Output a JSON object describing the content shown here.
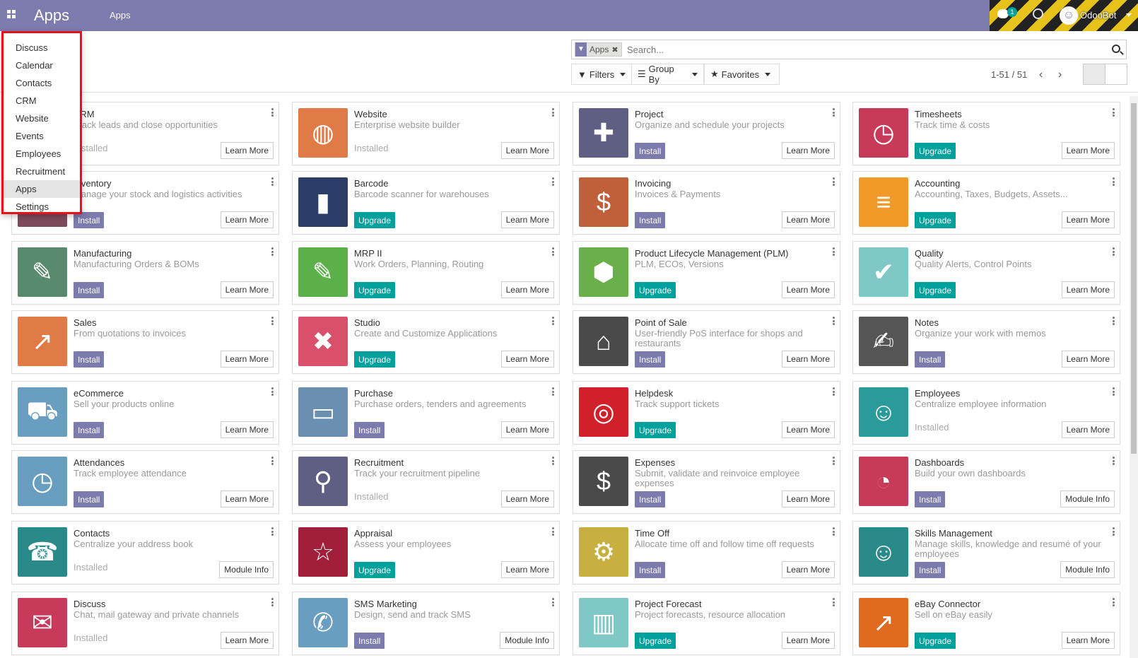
{
  "navbar": {
    "brand": "Apps",
    "menu_apps": "Apps",
    "chat_badge": "1",
    "user_name": "OdooBot"
  },
  "search": {
    "facet_label": "Apps",
    "placeholder": "Search..."
  },
  "filters": {
    "filters_label": "Filters",
    "group_by_label": "Group By",
    "favorites_label": "Favorites"
  },
  "pager": {
    "value": "1-51 / 51"
  },
  "dropdown": {
    "items": [
      "Discuss",
      "Calendar",
      "Contacts",
      "CRM",
      "Website",
      "Events",
      "Employees",
      "Recruitment",
      "Apps",
      "Settings"
    ],
    "active": "Apps"
  },
  "apps": [
    {
      "name": "CRM",
      "summary": "Track leads and close opportunities",
      "status": "Installed",
      "more": "Learn More",
      "color": "#c0504d",
      "icon": "handshake-icon",
      "glyph": "★"
    },
    {
      "name": "Website",
      "summary": "Enterprise website builder",
      "status": "Installed",
      "more": "Learn More",
      "color": "#e07a47",
      "icon": "globe-icon",
      "glyph": "◍"
    },
    {
      "name": "Project",
      "summary": "Organize and schedule your projects",
      "status": "Install",
      "more": "Learn More",
      "color": "#5e5f82",
      "icon": "puzzle-icon",
      "glyph": "✚"
    },
    {
      "name": "Timesheets",
      "summary": "Track time & costs",
      "status": "Upgrade",
      "more": "Learn More",
      "color": "#c83a5a",
      "icon": "clock-icon",
      "glyph": "◷"
    },
    {
      "name": "Inventory",
      "summary": "Manage your stock and logistics activities",
      "status": "Install",
      "more": "Learn More",
      "color": "#7c4a5b",
      "icon": "box-icon",
      "glyph": "■"
    },
    {
      "name": "Barcode",
      "summary": "Barcode scanner for warehouses",
      "status": "Upgrade",
      "more": "Learn More",
      "color": "#2c3e68",
      "icon": "barcode-icon",
      "glyph": "▮"
    },
    {
      "name": "Invoicing",
      "summary": "Invoices & Payments",
      "status": "Install",
      "more": "Learn More",
      "color": "#c0603a",
      "icon": "invoice-icon",
      "glyph": "$"
    },
    {
      "name": "Accounting",
      "summary": "Accounting, Taxes, Budgets, Assets...",
      "status": "Upgrade",
      "more": "Learn More",
      "color": "#f09a2a",
      "icon": "document-icon",
      "glyph": "≡"
    },
    {
      "name": "Manufacturing",
      "summary": "Manufacturing Orders & BOMs",
      "status": "Install",
      "more": "Learn More",
      "color": "#5a8a6e",
      "icon": "wrench-icon",
      "glyph": "✎"
    },
    {
      "name": "MRP II",
      "summary": "Work Orders, Planning, Routing",
      "status": "Upgrade",
      "more": "Learn More",
      "color": "#5bb04a",
      "icon": "wrench-icon",
      "glyph": "✎"
    },
    {
      "name": "Product Lifecycle Management (PLM)",
      "summary": "PLM, ECOs, Versions",
      "status": "Upgrade",
      "more": "Learn More",
      "color": "#6ab04a",
      "icon": "cube-icon",
      "glyph": "⬢"
    },
    {
      "name": "Quality",
      "summary": "Quality Alerts, Control Points",
      "status": "Upgrade",
      "more": "Learn More",
      "color": "#7fc8c6",
      "icon": "clipboard-icon",
      "glyph": "✔"
    },
    {
      "name": "Sales",
      "summary": "From quotations to invoices",
      "status": "Install",
      "more": "Learn More",
      "color": "#e07a47",
      "icon": "chart-line-icon",
      "glyph": "↗"
    },
    {
      "name": "Studio",
      "summary": "Create and Customize Applications",
      "status": "Upgrade",
      "more": "Learn More",
      "color": "#d9506a",
      "icon": "tools-icon",
      "glyph": "✖"
    },
    {
      "name": "Point of Sale",
      "summary": "User-friendly PoS interface for shops and restaurants",
      "status": "Install",
      "more": "Learn More",
      "color": "#4a4a4a",
      "icon": "store-icon",
      "glyph": "⌂"
    },
    {
      "name": "Notes",
      "summary": "Organize your work with memos",
      "status": "Install",
      "more": "Learn More",
      "color": "#555555",
      "icon": "note-icon",
      "glyph": "✍"
    },
    {
      "name": "eCommerce",
      "summary": "Sell your products online",
      "status": "Install",
      "more": "Learn More",
      "color": "#6a9ec0",
      "icon": "cart-icon",
      "glyph": "⛟"
    },
    {
      "name": "Purchase",
      "summary": "Purchase orders, tenders and agreements",
      "status": "Install",
      "more": "Learn More",
      "color": "#6a8fb0",
      "icon": "credit-card-icon",
      "glyph": "▭"
    },
    {
      "name": "Helpdesk",
      "summary": "Track support tickets",
      "status": "Upgrade",
      "more": "Learn More",
      "color": "#d0202a",
      "icon": "lifebuoy-icon",
      "glyph": "◎"
    },
    {
      "name": "Employees",
      "summary": "Centralize employee information",
      "status": "Installed",
      "more": "Learn More",
      "color": "#2a9a9a",
      "icon": "users-icon",
      "glyph": "☺"
    },
    {
      "name": "Attendances",
      "summary": "Track employee attendance",
      "status": "Install",
      "more": "Learn More",
      "color": "#6a9ec0",
      "icon": "user-clock-icon",
      "glyph": "◷"
    },
    {
      "name": "Recruitment",
      "summary": "Track your recruitment pipeline",
      "status": "Installed",
      "more": "Learn More",
      "color": "#5e5f82",
      "icon": "magnifier-icon",
      "glyph": "⚲"
    },
    {
      "name": "Expenses",
      "summary": "Submit, validate and reinvoice employee expenses",
      "status": "Install",
      "more": "Learn More",
      "color": "#4a4a4a",
      "icon": "user-dollar-icon",
      "glyph": "$"
    },
    {
      "name": "Dashboards",
      "summary": "Build your own dashboards",
      "status": "Install",
      "more": "Module Info",
      "color": "#c83a5a",
      "icon": "gauge-icon",
      "glyph": "◔"
    },
    {
      "name": "Contacts",
      "summary": "Centralize your address book",
      "status": "Installed",
      "more": "Module Info",
      "color": "#2a8a8a",
      "icon": "address-book-icon",
      "glyph": "☎"
    },
    {
      "name": "Appraisal",
      "summary": "Assess your employees",
      "status": "Upgrade",
      "more": "Learn More",
      "color": "#a01e3a",
      "icon": "star-icon",
      "glyph": "☆"
    },
    {
      "name": "Time Off",
      "summary": "Allocate time off and follow time off requests",
      "status": "Install",
      "more": "Learn More",
      "color": "#c8b040",
      "icon": "user-gear-icon",
      "glyph": "⚙"
    },
    {
      "name": "Skills Management",
      "summary": "Manage skills, knowledge and resumé of your employees",
      "status": "Install",
      "more": "Module Info",
      "color": "#2a8a8a",
      "icon": "users-icon",
      "glyph": "☺"
    },
    {
      "name": "Discuss",
      "summary": "Chat, mail gateway and private channels",
      "status": "Installed",
      "more": "Learn More",
      "color": "#c83a5a",
      "icon": "chat-bubble-icon",
      "glyph": "✉"
    },
    {
      "name": "SMS Marketing",
      "summary": "Design, send and track SMS",
      "status": "Install",
      "more": "Module Info",
      "color": "#6a9ec0",
      "icon": "sms-icon",
      "glyph": "✆"
    },
    {
      "name": "Project Forecast",
      "summary": "Project forecasts, resource allocation",
      "status": "Upgrade",
      "more": "Learn More",
      "color": "#7fc8c6",
      "icon": "bar-chart-icon",
      "glyph": "▥"
    },
    {
      "name": "eBay Connector",
      "summary": "Sell on eBay easily",
      "status": "Upgrade",
      "more": "Learn More",
      "color": "#e06a20",
      "icon": "chart-line-icon",
      "glyph": "↗"
    }
  ]
}
